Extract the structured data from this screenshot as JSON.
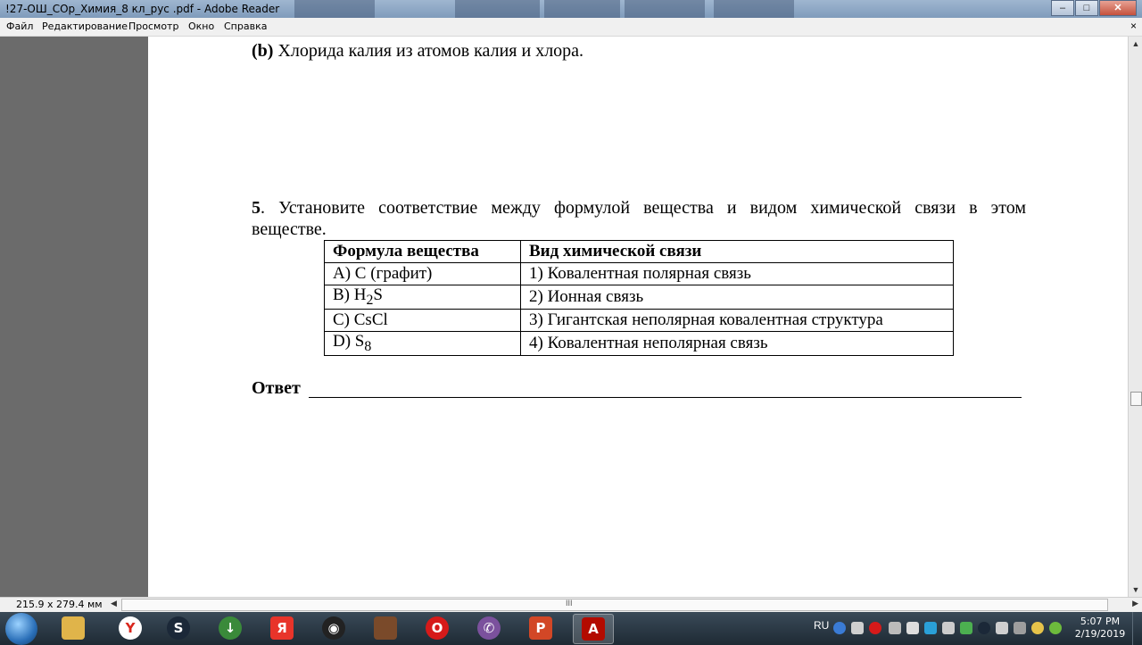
{
  "window": {
    "title": "!27-ОШ_СОр_Химия_8 кл_рус .pdf - Adobe Reader",
    "controls": {
      "minimize": "–",
      "maximize": "□",
      "close": "✕"
    }
  },
  "menu": {
    "items": [
      "Файл",
      "Редактирование",
      "Просмотр",
      "Окно",
      "Справка"
    ],
    "close_doc": "×"
  },
  "document": {
    "line_b_label": "(b)",
    "line_b_text": " Хлорида калия из атомов калия и хлора.",
    "q5_number": "5",
    "q5_text_line1": ". Установите соответствие между формулой вещества и видом химической связи в этом",
    "q5_text_line2": "веществе.",
    "table": {
      "headers": [
        "Формула вещества",
        "Вид химической связи"
      ],
      "rows": [
        {
          "formula": {
            "main": "A) С (графит)",
            "sub": "",
            "tail": ""
          },
          "bond": "1) Ковалентная полярная связь"
        },
        {
          "formula": {
            "main": "B) H",
            "sub": "2",
            "tail": "S"
          },
          "bond": "2) Ионная связь"
        },
        {
          "formula": {
            "main": "C) CsCl",
            "sub": "",
            "tail": ""
          },
          "bond": "3) Гигантская неполярная ковалентная структура"
        },
        {
          "formula": {
            "main": "D) S",
            "sub": "8",
            "tail": ""
          },
          "bond": "4) Ковалентная неполярная связь"
        }
      ]
    },
    "answer_label": "Ответ"
  },
  "statusbar": {
    "page_size": "215.9 x 279.4 мм",
    "grip": "III",
    "left_arrow": "◀",
    "right_arrow": "▶"
  },
  "scrollbar": {
    "up": "▲",
    "down": "▼"
  },
  "taskbar": {
    "apps": [
      {
        "name": "file-explorer",
        "glyph": "",
        "color": "#e0b44a"
      },
      {
        "name": "yandex-browser",
        "glyph": "Y",
        "color": "#d9261c"
      },
      {
        "name": "steam",
        "glyph": "S",
        "color": "#1b2838"
      },
      {
        "name": "app-green-down",
        "glyph": "↓",
        "color": "#3a8a3a"
      },
      {
        "name": "yandex",
        "glyph": "Я",
        "color": "#e8342a"
      },
      {
        "name": "obs",
        "glyph": "◉",
        "color": "#222"
      },
      {
        "name": "game-character",
        "glyph": "",
        "color": "#7a4a2a"
      },
      {
        "name": "opera",
        "glyph": "O",
        "color": "#d61a1a"
      },
      {
        "name": "viber",
        "glyph": "✆",
        "color": "#7b519d"
      },
      {
        "name": "presentation",
        "glyph": "P",
        "color": "#d24726"
      },
      {
        "name": "adobe-reader",
        "glyph": "A",
        "color": "#b30b00"
      }
    ],
    "lang": "RU",
    "time": "5:07 PM",
    "date": "2/19/2019"
  }
}
